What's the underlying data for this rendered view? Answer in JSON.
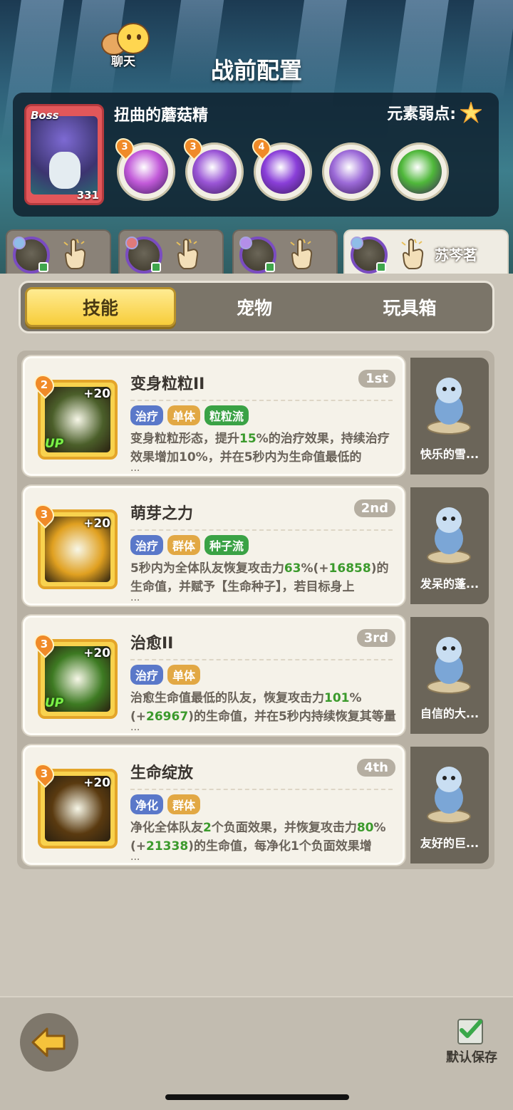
{
  "header": {
    "chat_label": "聊天",
    "title": "战前配置"
  },
  "boss": {
    "tag": "Boss",
    "level": "331",
    "name": "扭曲的蘑菇精",
    "weakness_label": "元素弱点:",
    "weakness_icon": "light-star-icon",
    "skills": [
      {
        "level": "3",
        "icon": "pink-swirl-icon",
        "color": "#c25ad9"
      },
      {
        "level": "3",
        "icon": "purple-drop-icon",
        "color": "#9a55d6"
      },
      {
        "level": "4",
        "icon": "mushroom-burst-icon",
        "color": "#8a3fd9"
      },
      {
        "level": "",
        "icon": "mushroom-icon",
        "color": "#9c6ad8"
      },
      {
        "level": "",
        "icon": "green-slime-icon",
        "color": "#4fb83a"
      }
    ]
  },
  "hero_tabs": [
    {
      "name": "",
      "active": false,
      "element_color": "#8fbde8"
    },
    {
      "name": "",
      "active": false,
      "element_color": "#e07a7a"
    },
    {
      "name": "",
      "active": false,
      "element_color": "#b48ee8"
    },
    {
      "name": "苏芩茗",
      "active": true,
      "element_color": "#8fbde8"
    }
  ],
  "tabs": [
    "技能",
    "宠物",
    "玩具箱"
  ],
  "skills": [
    {
      "level": "2",
      "bonus": "+20",
      "up": "UP",
      "name": "变身粒粒II",
      "order": "1st",
      "tags": [
        {
          "text": "治疗",
          "color": "#5a78c9"
        },
        {
          "text": "单体",
          "color": "#e2a844"
        },
        {
          "text": "粒粒流",
          "color": "#3aa245"
        }
      ],
      "desc_parts": [
        "变身粒粒形态，提升",
        "15",
        "%的治疗效果，持续治疗效果增加10%，并在5秒内为生命值最低的"
      ],
      "ellipsis": "...",
      "art_color": "#4b5f2a",
      "pet": {
        "name": "快乐的雪...",
        "icon": "snow-sheep-figure-icon"
      }
    },
    {
      "level": "3",
      "bonus": "+20",
      "up": "",
      "name": "萌芽之力",
      "order": "2nd",
      "tags": [
        {
          "text": "治疗",
          "color": "#5a78c9"
        },
        {
          "text": "群体",
          "color": "#e2a844"
        },
        {
          "text": "种子流",
          "color": "#3aa245"
        }
      ],
      "desc_parts": [
        "5秒内为全体队友恢复攻击力",
        "63",
        "%(+",
        "16858",
        ")的生命值，并赋予【生命种子】，若目标身上"
      ],
      "ellipsis": "...",
      "art_color": "#e0a020",
      "pet": {
        "name": "发呆的蓬...",
        "icon": "fluffy-sheep-figure-icon"
      }
    },
    {
      "level": "3",
      "bonus": "+20",
      "up": "UP",
      "name": "治愈II",
      "order": "3rd",
      "tags": [
        {
          "text": "治疗",
          "color": "#5a78c9"
        },
        {
          "text": "单体",
          "color": "#e2a844"
        }
      ],
      "desc_parts": [
        "治愈生命值最低的队友，恢复攻击力",
        "101",
        "%(+",
        "26967",
        ")的生命值，并在5秒内持续恢复其等量"
      ],
      "ellipsis": "...",
      "art_color": "#3d7a22",
      "pet": {
        "name": "自信的大...",
        "icon": "goat-figure-icon"
      }
    },
    {
      "level": "3",
      "bonus": "+20",
      "up": "",
      "name": "生命绽放",
      "order": "4th",
      "tags": [
        {
          "text": "净化",
          "color": "#5a78c9"
        },
        {
          "text": "群体",
          "color": "#e2a844"
        }
      ],
      "desc_parts": [
        "净化全体队友",
        "2",
        "个负面效果，并恢复攻击力",
        "80",
        "%(+",
        "21338",
        ")的生命值，每净化1个负面效果增"
      ],
      "ellipsis": "...",
      "art_color": "#5a3a10",
      "pet": {
        "name": "友好的巨...",
        "icon": "robot-figure-icon"
      }
    }
  ],
  "footer": {
    "back_icon": "back-arrow-icon",
    "save_label": "默认保存",
    "save_checked": true
  }
}
